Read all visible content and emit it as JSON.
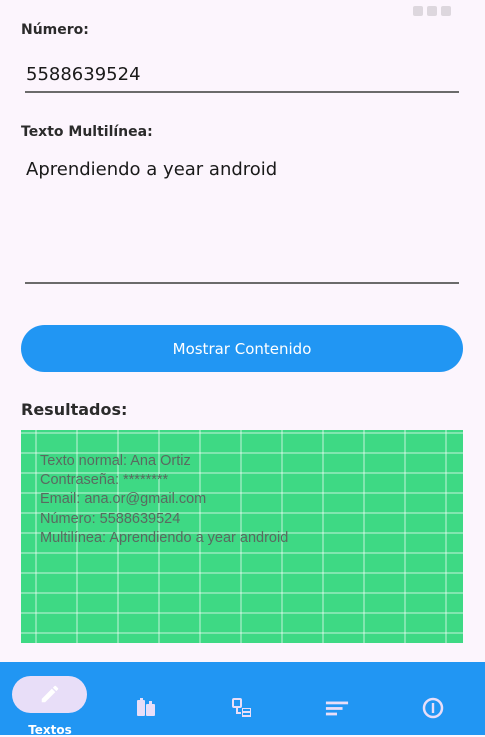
{
  "form": {
    "numero_label": "Número:",
    "numero_value": "5588639524",
    "multiline_label": "Texto Multilínea:",
    "multiline_value": "Aprendiendo a year android"
  },
  "actions": {
    "show_button_label": "Mostrar Contenido"
  },
  "results": {
    "title": "Resultados:",
    "lines": [
      "Texto normal: Ana Ortiz",
      "Contraseña: ********",
      "Email: ana.or@gmail.com",
      "Número: 5588639524",
      "Multilínea: Aprendiendo a year android"
    ]
  },
  "bottom_nav": {
    "items": [
      {
        "label": "Textos",
        "icon": "pencil-icon",
        "selected": true
      },
      {
        "label": "",
        "icon": "id-card-icon",
        "selected": false
      },
      {
        "label": "",
        "icon": "checklist-icon",
        "selected": false
      },
      {
        "label": "",
        "icon": "sort-lines-icon",
        "selected": false
      },
      {
        "label": "",
        "icon": "info-icon",
        "selected": false
      }
    ]
  },
  "colors": {
    "background": "#FCF5FD",
    "accent": "#2196F3",
    "results_bg": "#3ED984",
    "nav_pill": "#E8DEF8"
  }
}
